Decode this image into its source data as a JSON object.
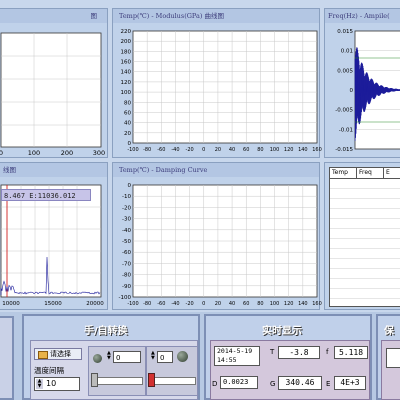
{
  "panels": {
    "p1": {
      "title": "图",
      "xticks": [
        "0",
        "100",
        "200",
        "300"
      ]
    },
    "p2": {
      "title": "Temp(℃) - Modulus(GPa) 曲线图",
      "yticks": [
        "220",
        "200",
        "180",
        "160",
        "140",
        "120",
        "100",
        "80",
        "60",
        "40",
        "20",
        "0"
      ],
      "xticks": [
        "-100",
        "-80",
        "-60",
        "-40",
        "-20",
        "0",
        "20",
        "40",
        "60",
        "80",
        "100",
        "120",
        "140",
        "160"
      ]
    },
    "p3": {
      "title": "Freq(Hz) - Ampile(",
      "yticks": [
        "0.015",
        "0.01",
        "0.005",
        "0",
        "-0.005",
        "-0.01",
        "-0.015"
      ]
    },
    "p4": {
      "title": "线图",
      "cursor": "8.467 E:11036.012",
      "xticks": [
        "10000",
        "15000",
        "20000"
      ]
    },
    "p5": {
      "title": "Temp(℃) - Damping  Curve",
      "yticks": [
        "0",
        "-10",
        "-20",
        "-30",
        "-40",
        "-50",
        "-60",
        "-70",
        "-80",
        "-90",
        "-100"
      ],
      "xticks": [
        "-100",
        "-80",
        "-60",
        "-40",
        "-20",
        "0",
        "20",
        "40",
        "60",
        "80",
        "100",
        "120",
        "140",
        "160"
      ]
    },
    "p6": {
      "columns": [
        "Temp",
        "Freq",
        "E"
      ]
    }
  },
  "controls": {
    "heading": "手/自转换",
    "choose_button": "请选择",
    "interval_label": "温度间隔",
    "interval_value": "10",
    "knob1_value": "0",
    "knob2_value": "0"
  },
  "realtime": {
    "heading": "实时显示",
    "datetime": "2014-5-19\n14:55",
    "t_label": "T",
    "t_value": "-3.8",
    "f_label": "f",
    "f_value": "5.118",
    "d_label": "D",
    "d_value": "0.0023",
    "g_label": "G",
    "g_value": "340.46",
    "e_label": "E",
    "e_value": "4E+3"
  },
  "right_panel": {
    "heading": "保"
  }
}
